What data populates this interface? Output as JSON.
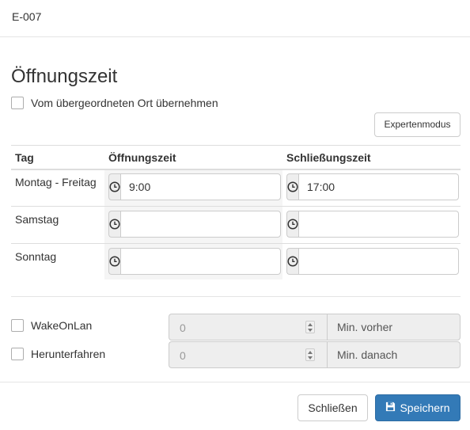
{
  "header": {
    "title": "E-007"
  },
  "section": {
    "title": "Öffnungszeit",
    "inherit_label": "Vom übergeordneten Ort übernehmen",
    "expert_button": "Expertenmodus"
  },
  "table": {
    "columns": [
      "Tag",
      "Öffnungszeit",
      "Schließungszeit"
    ],
    "rows": [
      {
        "day": "Montag - Freitag",
        "open": "9:00",
        "close": "17:00"
      },
      {
        "day": "Samstag",
        "open": "",
        "close": ""
      },
      {
        "day": "Sonntag",
        "open": "",
        "close": ""
      }
    ]
  },
  "options": {
    "wakeonlan": {
      "label": "WakeOnLan",
      "value": "0",
      "unit": "Min. vorher"
    },
    "shutdown": {
      "label": "Herunterfahren",
      "value": "0",
      "unit": "Min. danach"
    }
  },
  "footer": {
    "close_label": "Schließen",
    "save_label": "Speichern"
  },
  "icons": {
    "time": "clock-icon",
    "save": "floppy-disk-icon"
  },
  "colors": {
    "primary": "#337ab7",
    "addon_bg": "#eeeeee",
    "border": "#cccccc"
  }
}
